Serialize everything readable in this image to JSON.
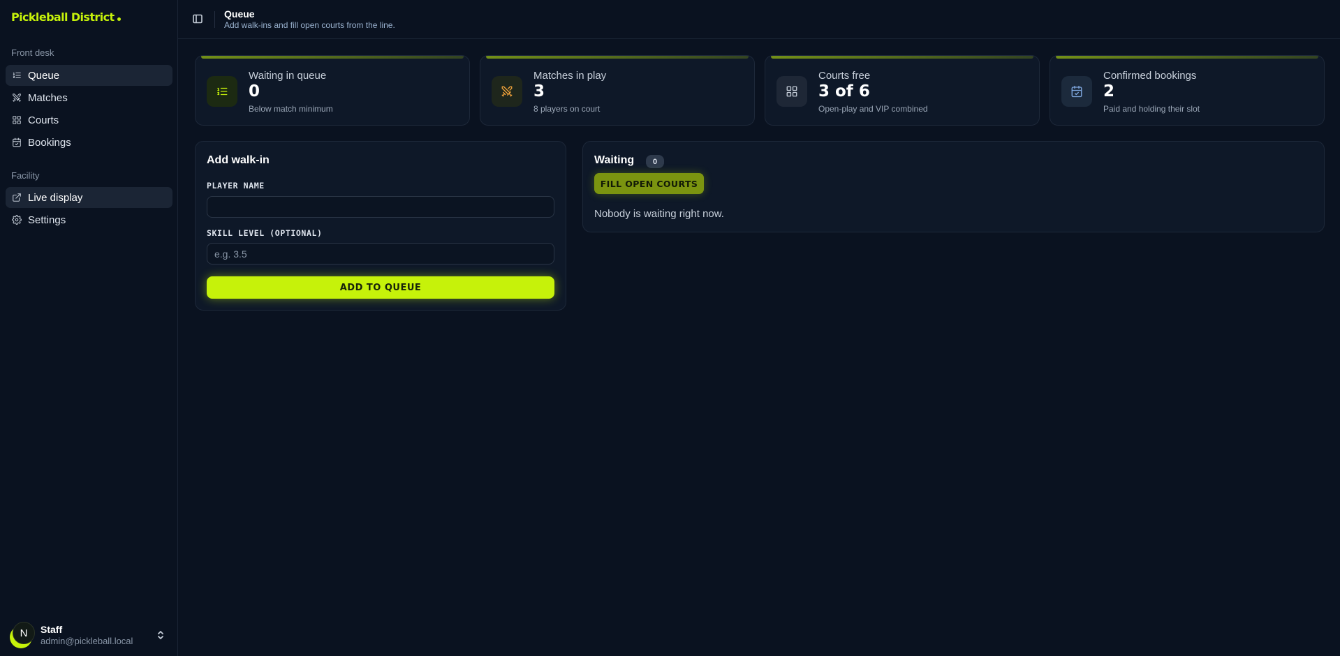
{
  "brand": {
    "name": "Pickleball District"
  },
  "sidebar": {
    "groups": [
      {
        "label": "Front desk"
      },
      {
        "label": "Facility"
      }
    ],
    "items": [
      {
        "label": "Queue",
        "icon": "list-ordered-icon",
        "active": true
      },
      {
        "label": "Matches",
        "icon": "swords-icon",
        "active": false
      },
      {
        "label": "Courts",
        "icon": "grid-icon",
        "active": false
      },
      {
        "label": "Bookings",
        "icon": "calendar-check-icon",
        "active": false
      },
      {
        "label": "Live display",
        "icon": "external-link-icon",
        "active": false
      },
      {
        "label": "Settings",
        "icon": "gear-icon",
        "active": false
      }
    ],
    "user": {
      "initial": "N",
      "name": "Staff",
      "email": "admin@pickleball.local"
    }
  },
  "header": {
    "title": "Queue",
    "subtitle": "Add walk-ins and fill open courts from the line."
  },
  "stats": [
    {
      "label": "Waiting in queue",
      "value": "0",
      "note": "Below match minimum",
      "icon": "list-ordered-icon",
      "accent": "#c6f20a"
    },
    {
      "label": "Matches in play",
      "value": "3",
      "note": "8 players on court",
      "icon": "swords-icon",
      "accent": "#f0a23a"
    },
    {
      "label": "Courts free",
      "value": "3 of 6",
      "note": "Open-play and VIP combined",
      "icon": "grid-icon",
      "accent": "#c5cdd8"
    },
    {
      "label": "Confirmed bookings",
      "value": "2",
      "note": "Paid and holding their slot",
      "icon": "calendar-check-icon",
      "accent": "#7fa8e0"
    }
  ],
  "walkin": {
    "title": "Add walk-in",
    "name_label": "PLAYER NAME",
    "name_value": "",
    "name_placeholder": "",
    "skill_label": "SKILL LEVEL (OPTIONAL)",
    "skill_value": "",
    "skill_placeholder": "e.g. 3.5",
    "submit_label": "ADD TO QUEUE"
  },
  "waiting": {
    "title": "Waiting",
    "count": "0",
    "fill_label": "FILL OPEN COURTS",
    "empty_text": "Nobody is waiting right now."
  },
  "colors": {
    "accent": "#c6f20a",
    "background": "#0a1220",
    "card": "#0e1828"
  }
}
